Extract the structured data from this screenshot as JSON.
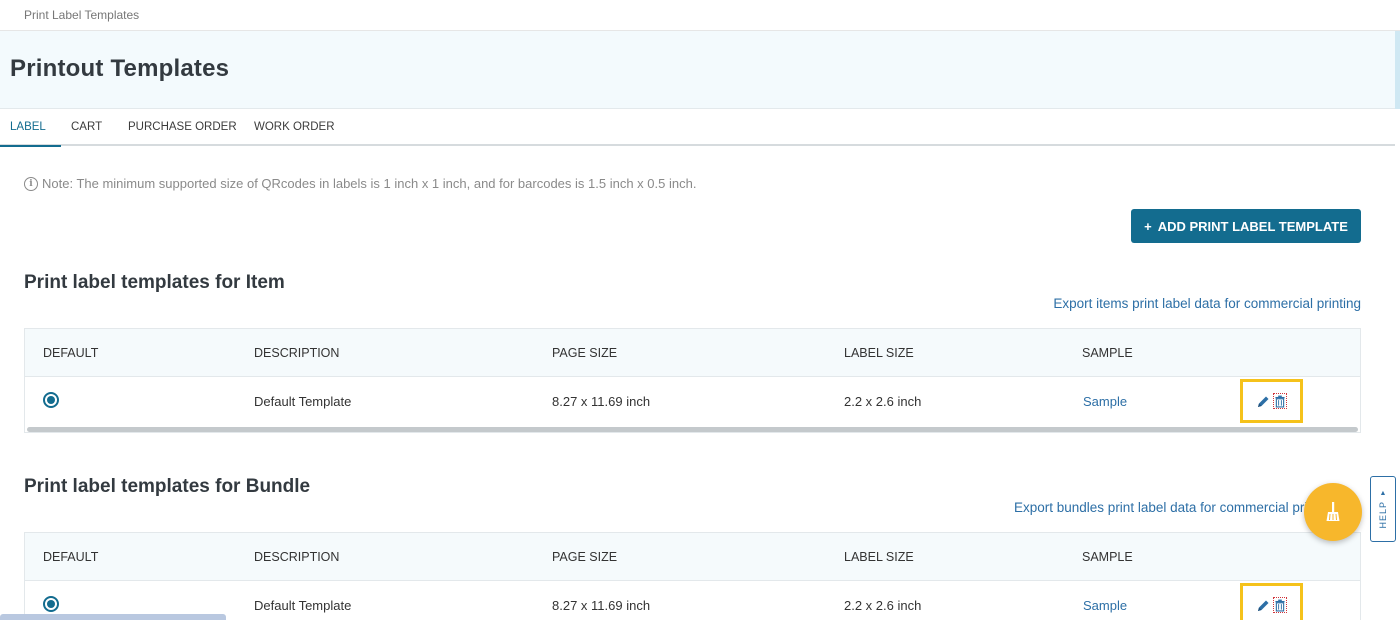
{
  "breadcrumb": "Print Label Templates",
  "page_title": "Printout Templates",
  "tabs": [
    {
      "label": "LABEL",
      "active": true
    },
    {
      "label": "CART",
      "active": false
    },
    {
      "label": "PURCHASE ORDER",
      "active": false
    },
    {
      "label": "WORK ORDER",
      "active": false
    }
  ],
  "note": "Note: The minimum supported size of QRcodes in labels is 1 inch x 1 inch, and for barcodes is 1.5 inch x 0.5 inch.",
  "add_button": {
    "icon": "+",
    "label": "ADD PRINT LABEL TEMPLATE"
  },
  "columns": {
    "default": "DEFAULT",
    "description": "DESCRIPTION",
    "page_size": "PAGE SIZE",
    "label_size": "LABEL SIZE",
    "sample": "SAMPLE"
  },
  "item_section": {
    "title": "Print label templates for Item",
    "export_link": "Export items print label data for commercial printing",
    "rows": [
      {
        "description": "Default Template",
        "page_size": "8.27 x 11.69 inch",
        "label_size": "2.2 x 2.6 inch",
        "sample": "Sample",
        "selected": true
      }
    ]
  },
  "bundle_section": {
    "title": "Print label templates for Bundle",
    "export_link": "Export bundles print label data for commercial printing",
    "rows": [
      {
        "description": "Default Template",
        "page_size": "8.27 x 11.69 inch",
        "label_size": "2.2 x 2.6 inch",
        "sample": "Sample",
        "selected": true
      }
    ]
  },
  "help": {
    "label": "HELP"
  },
  "colors": {
    "primary": "#136c8f",
    "link": "#2d6fa6",
    "highlight": "#f5c21b",
    "fab": "#f7b72c",
    "delete": "#d0343b"
  },
  "icons": {
    "info": "info-circle-icon",
    "edit": "pencil-icon",
    "delete": "trash-icon",
    "fab": "broom-icon",
    "help_caret": "caret-up-icon"
  }
}
